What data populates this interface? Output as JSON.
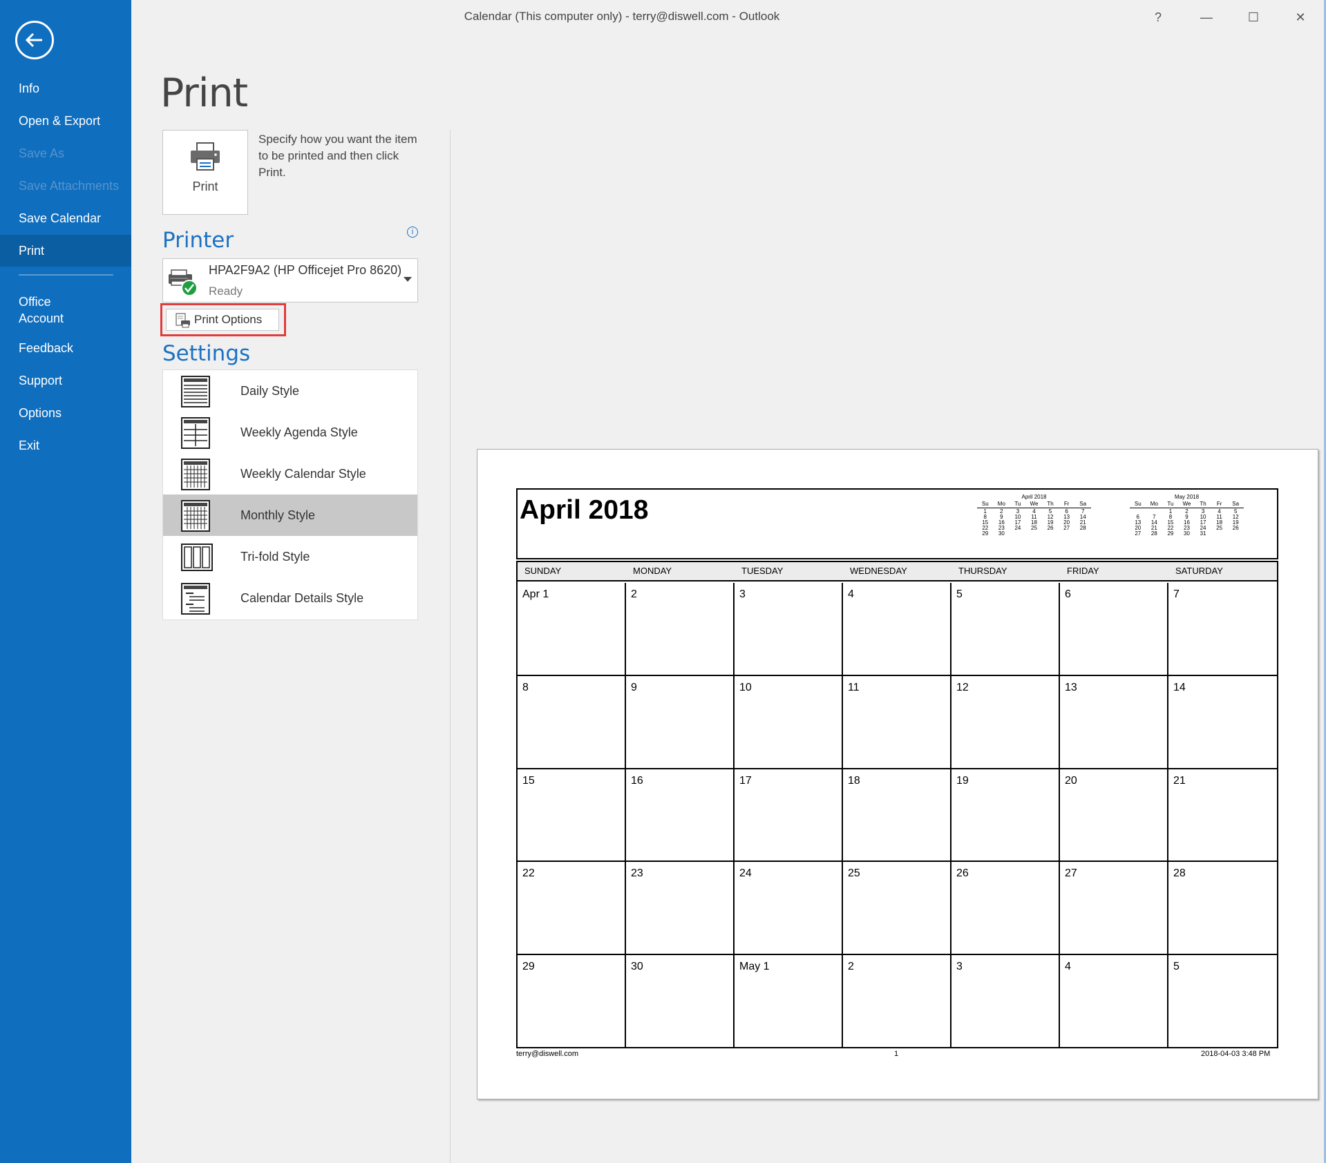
{
  "window": {
    "title": "Calendar (This computer only) - terry@diswell.com  -  Outlook",
    "help": "?",
    "minimize": "—",
    "maximize": "☐",
    "close": "✕"
  },
  "sidebar": {
    "items": [
      {
        "label": "Info"
      },
      {
        "label": "Open & Export"
      },
      {
        "label": "Save As"
      },
      {
        "label": "Save Attachments"
      },
      {
        "label": "Save Calendar"
      },
      {
        "label": "Print"
      },
      {
        "label": "Office\nAccount"
      },
      {
        "label": "Feedback"
      },
      {
        "label": "Support"
      },
      {
        "label": "Options"
      },
      {
        "label": "Exit"
      }
    ]
  },
  "main": {
    "title": "Print",
    "print_button_label": "Print",
    "description": "Specify how you want the item to be printed and then click Print.",
    "printer_heading": "Printer",
    "printer_name": "HPA2F9A2 (HP Officejet Pro 8620)",
    "printer_status": "Ready",
    "print_options_label": "Print Options",
    "settings_heading": "Settings",
    "styles": [
      {
        "label": "Daily Style"
      },
      {
        "label": "Weekly Agenda Style"
      },
      {
        "label": "Weekly Calendar Style"
      },
      {
        "label": "Monthly Style"
      },
      {
        "label": "Tri-fold Style"
      },
      {
        "label": "Calendar Details Style"
      }
    ],
    "selected_style": "Monthly Style"
  },
  "preview": {
    "month_title": "April 2018",
    "mini_april": {
      "title": "April 2018",
      "dow": [
        "Su",
        "Mo",
        "Tu",
        "We",
        "Th",
        "Fr",
        "Sa"
      ],
      "days": [
        "1",
        "2",
        "3",
        "4",
        "5",
        "6",
        "7",
        "8",
        "9",
        "10",
        "11",
        "12",
        "13",
        "14",
        "15",
        "16",
        "17",
        "18",
        "19",
        "20",
        "21",
        "22",
        "23",
        "24",
        "25",
        "26",
        "27",
        "28",
        "29",
        "30",
        "",
        "",
        "",
        "",
        ""
      ]
    },
    "mini_may": {
      "title": "May 2018",
      "dow": [
        "Su",
        "Mo",
        "Tu",
        "We",
        "Th",
        "Fr",
        "Sa"
      ],
      "days": [
        "",
        "",
        "1",
        "2",
        "3",
        "4",
        "5",
        "6",
        "7",
        "8",
        "9",
        "10",
        "11",
        "12",
        "13",
        "14",
        "15",
        "16",
        "17",
        "18",
        "19",
        "20",
        "21",
        "22",
        "23",
        "24",
        "25",
        "26",
        "27",
        "28",
        "29",
        "30",
        "31",
        "",
        ""
      ]
    },
    "weekdays": [
      "SUNDAY",
      "MONDAY",
      "TUESDAY",
      "WEDNESDAY",
      "THURSDAY",
      "FRIDAY",
      "SATURDAY"
    ],
    "weeks": [
      [
        "Apr 1",
        "2",
        "3",
        "4",
        "5",
        "6",
        "7"
      ],
      [
        "8",
        "9",
        "10",
        "11",
        "12",
        "13",
        "14"
      ],
      [
        "15",
        "16",
        "17",
        "18",
        "19",
        "20",
        "21"
      ],
      [
        "22",
        "23",
        "24",
        "25",
        "26",
        "27",
        "28"
      ],
      [
        "29",
        "30",
        "May 1",
        "2",
        "3",
        "4",
        "5"
      ]
    ],
    "footer_left": "terry@diswell.com",
    "footer_center": "1",
    "footer_right": "2018-04-03 3:48 PM"
  }
}
